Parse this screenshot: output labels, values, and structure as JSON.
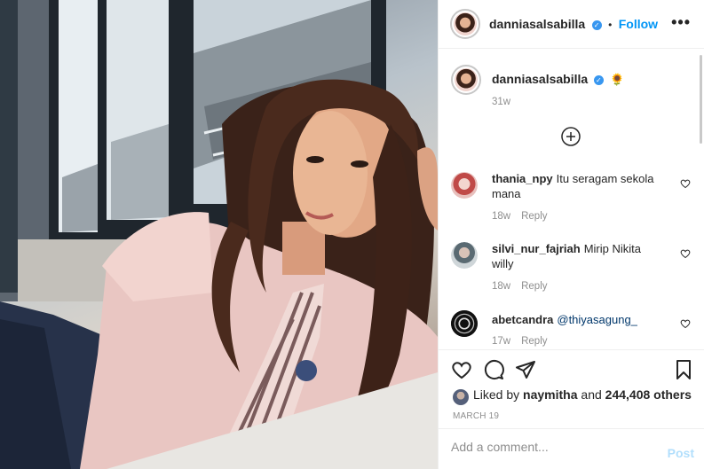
{
  "post": {
    "username": "danniasalsabilla",
    "verified_mark": "✓",
    "separator": "•",
    "follow_label": "Follow",
    "more_icon": "more-horizontal-icon",
    "caption_emoji": "🌻",
    "caption_time": "31w",
    "likes_prefix": "Liked by",
    "likes_user": "naymitha",
    "likes_and": "and",
    "likes_count": "244,408 others",
    "date": "MARCH 19"
  },
  "comments": [
    {
      "username": "thania_npy",
      "text": "Itu seragam sekola mana",
      "time": "18w",
      "reply": "Reply"
    },
    {
      "username": "silvi_nur_fajriah",
      "text": "Mirip Nikita willy",
      "time": "18w",
      "reply": "Reply"
    },
    {
      "username": "abetcandra",
      "text": "@thiyasagung_",
      "time": "17w",
      "reply": "Reply"
    }
  ],
  "add_comment": {
    "placeholder": "Add a comment...",
    "post_label": "Post"
  },
  "colors": {
    "accent": "#0095f6",
    "verified": "#3897f0",
    "muted": "#8e8e8e",
    "post_disabled": "#b2dffc"
  }
}
